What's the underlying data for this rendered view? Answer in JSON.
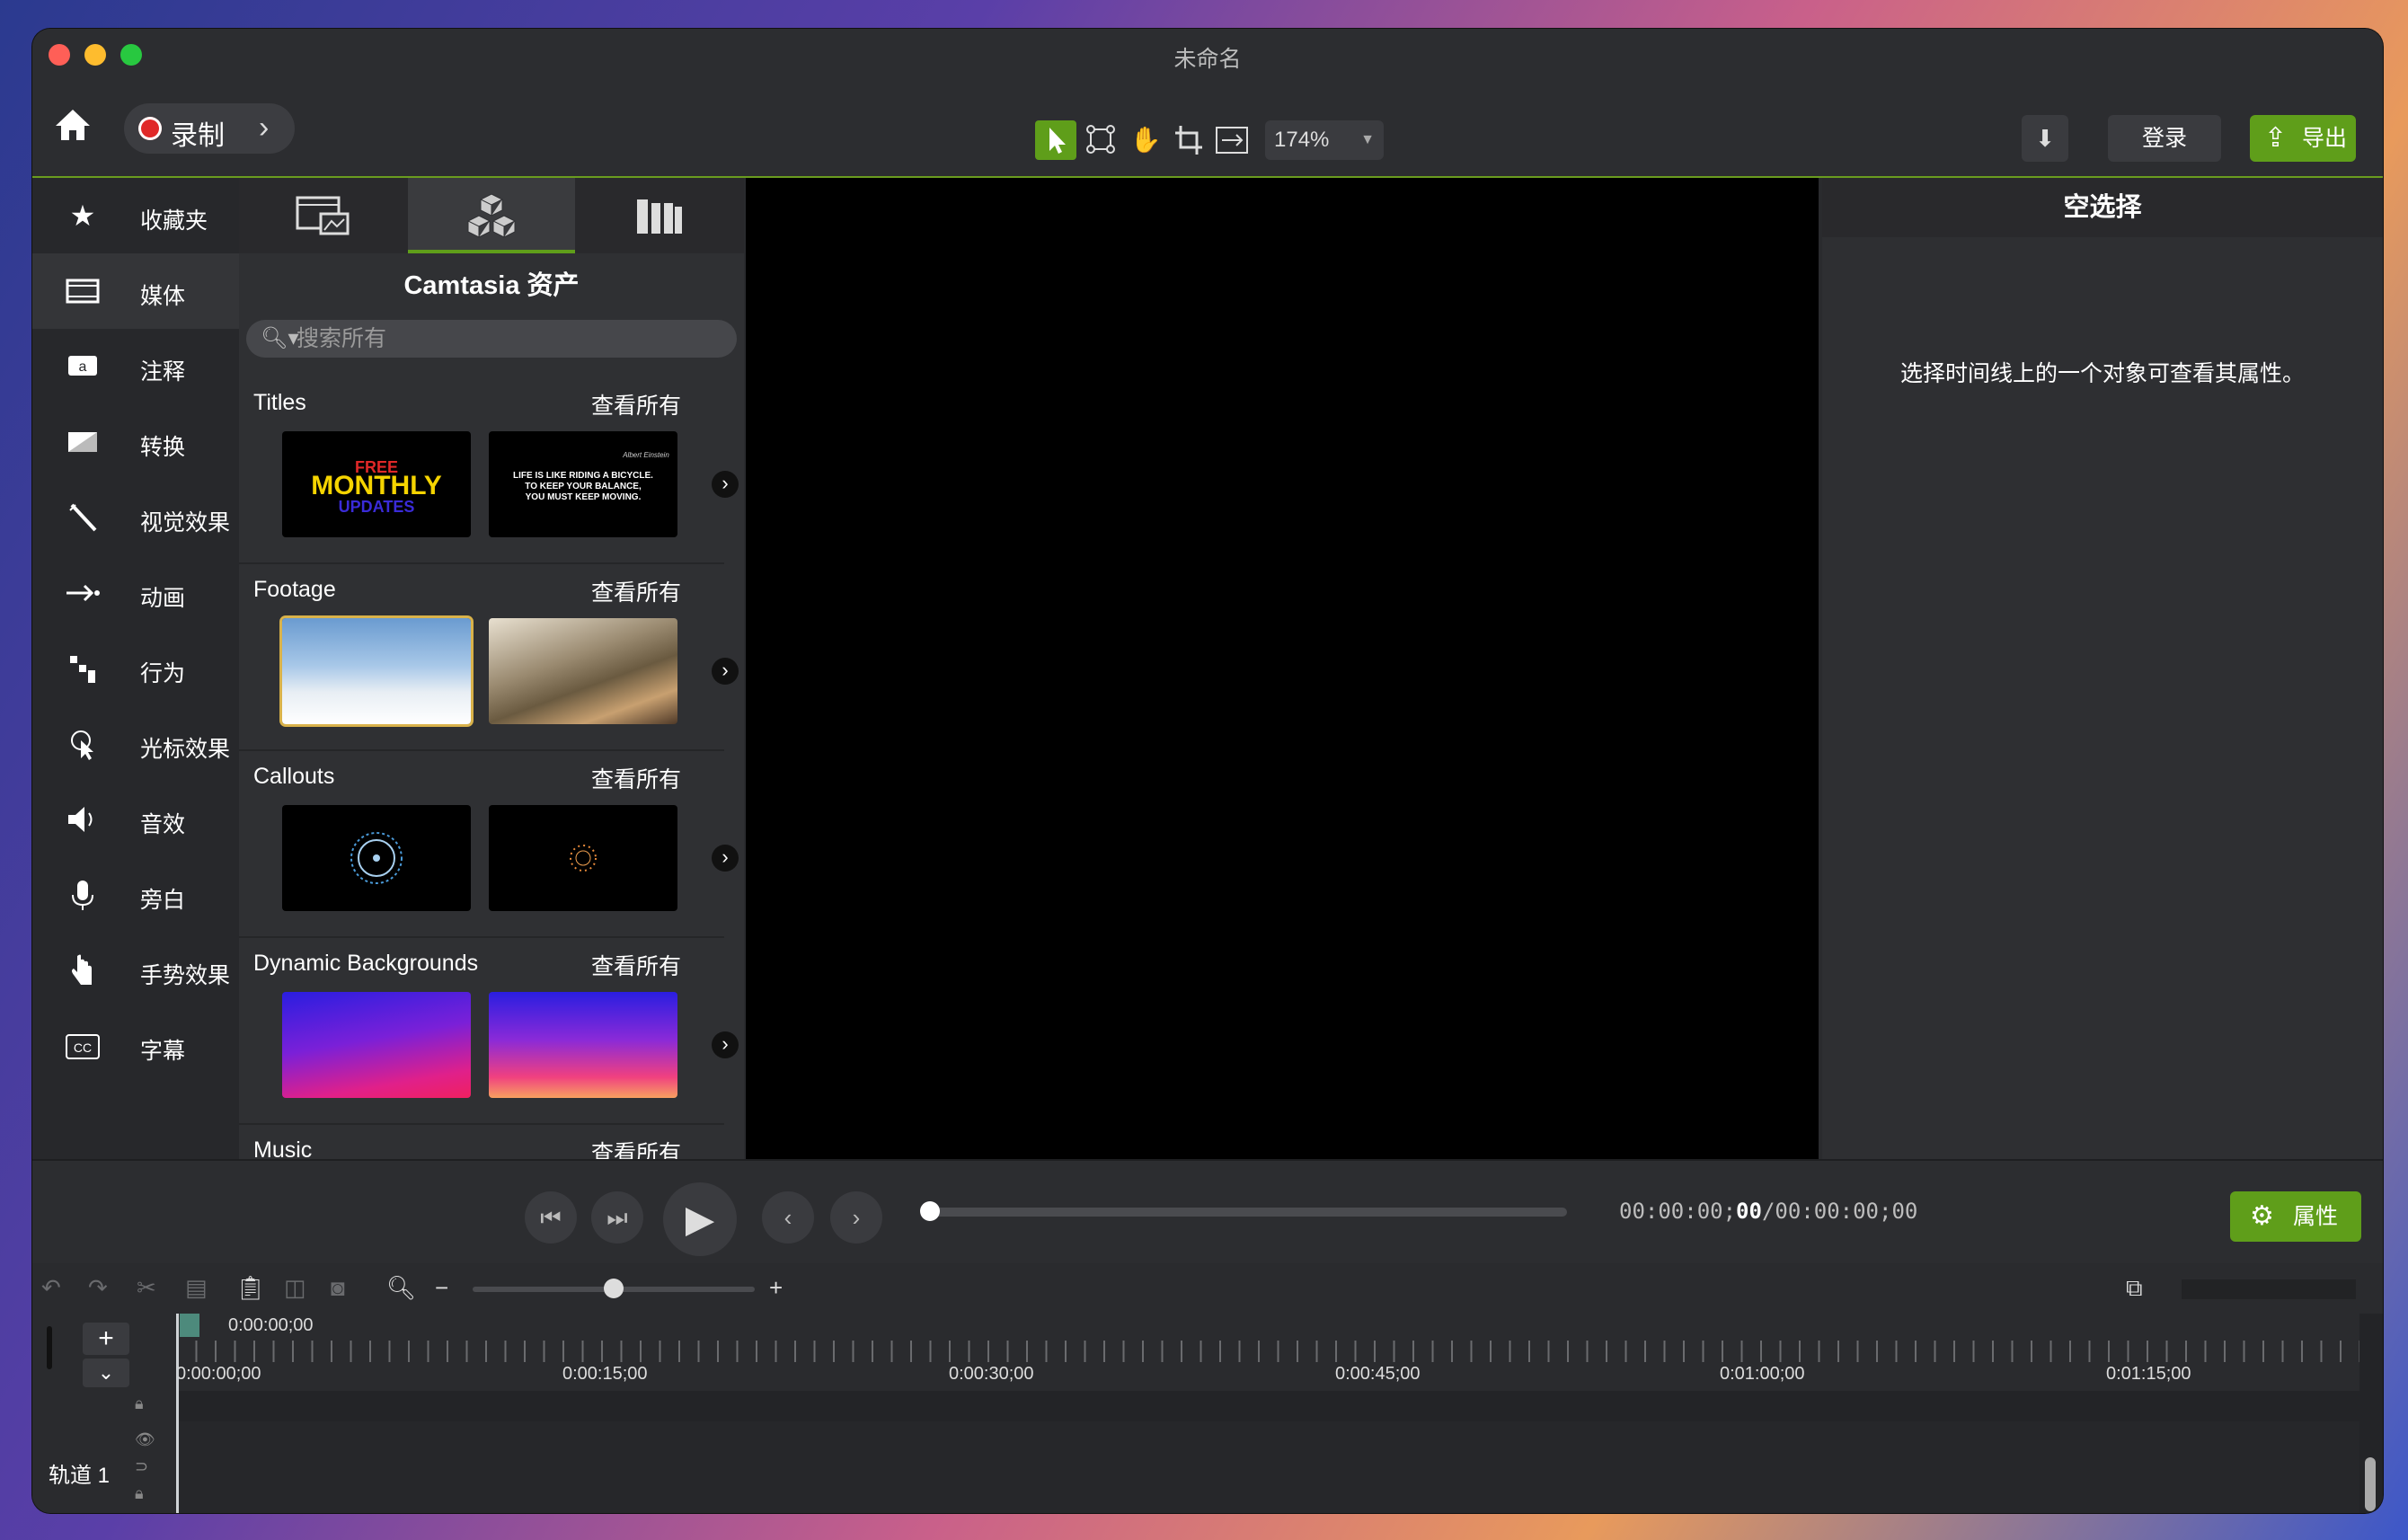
{
  "window": {
    "title": "未命名"
  },
  "toolbar": {
    "record_label": "录制",
    "zoom": "174%",
    "login_label": "登录",
    "export_label": "导出",
    "colors": {
      "accent": "#5f9e1a",
      "record": "#e02828"
    }
  },
  "nav": [
    {
      "label": "收藏夹",
      "icon": "star-icon"
    },
    {
      "label": "媒体",
      "icon": "film-icon"
    },
    {
      "label": "注释",
      "icon": "annotation-icon"
    },
    {
      "label": "转换",
      "icon": "transition-icon"
    },
    {
      "label": "视觉效果",
      "icon": "magic-wand-icon"
    },
    {
      "label": "动画",
      "icon": "animation-arrow-icon"
    },
    {
      "label": "行为",
      "icon": "behavior-icon"
    },
    {
      "label": "光标效果",
      "icon": "cursor-effect-icon"
    },
    {
      "label": "音效",
      "icon": "speaker-icon"
    },
    {
      "label": "旁白",
      "icon": "microphone-icon"
    },
    {
      "label": "手势效果",
      "icon": "hand-gesture-icon"
    },
    {
      "label": "字幕",
      "icon": "closed-caption-icon"
    }
  ],
  "assets": {
    "title": "Camtasia 资产",
    "search_placeholder": "搜索所有",
    "sections": [
      {
        "name": "Titles",
        "view_all": "查看所有"
      },
      {
        "name": "Footage",
        "view_all": "查看所有"
      },
      {
        "name": "Callouts",
        "view_all": "查看所有"
      },
      {
        "name": "Dynamic Backgrounds",
        "view_all": "查看所有"
      },
      {
        "name": "Music",
        "view_all": "查看所有"
      }
    ],
    "title_thumb_1": {
      "line1": "FREE",
      "line2": "MONTHLY",
      "line3": "UPDATES"
    },
    "title_thumb_2": {
      "author": "Albert Einstein",
      "line1": "LIFE IS LIKE RIDING A BICYCLE.",
      "line2": "TO KEEP YOUR BALANCE,",
      "line3": "YOU MUST KEEP MOVING."
    }
  },
  "properties": {
    "header": "空选择",
    "message": "选择时间线上的一个对象可查看其属性。",
    "button_label": "属性"
  },
  "transport": {
    "timecode_current": "00:00:00;",
    "timecode_frame": "00",
    "timecode_total": "/00:00:00;00"
  },
  "timeline": {
    "current_time": "0:00:00;00",
    "ruler_labels": [
      "0:00:00;00",
      "0:00:15;00",
      "0:00:30;00",
      "0:00:45;00",
      "0:01:00;00",
      "0:01:15;00"
    ],
    "track_name": "轨道 1"
  }
}
